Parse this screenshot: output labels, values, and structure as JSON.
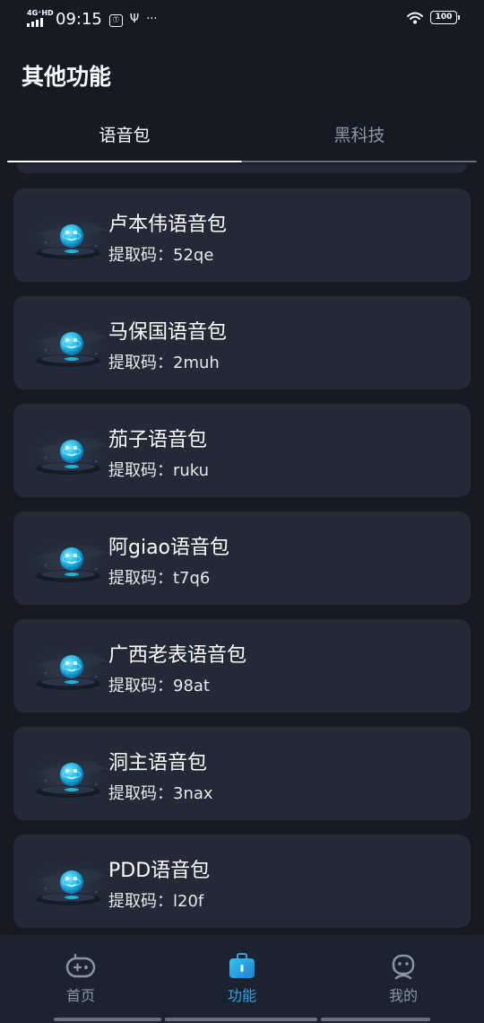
{
  "status_bar": {
    "network": "4G⁺HD",
    "time": "09:15",
    "notif_badge": "Ⓣ",
    "usb_glyph": "Ψ",
    "more": "···",
    "battery": "100"
  },
  "header": {
    "title": "其他功能"
  },
  "tabs": [
    {
      "label": "语音包",
      "active": true
    },
    {
      "label": "黑科技",
      "active": false
    }
  ],
  "voice_packs": [
    {
      "title": "卢本伟语音包",
      "code_label": "提取码：",
      "code": "52qe"
    },
    {
      "title": "马保国语音包",
      "code_label": "提取码：",
      "code": "2muh"
    },
    {
      "title": "茄子语音包",
      "code_label": "提取码：",
      "code": "ruku"
    },
    {
      "title": "阿giao语音包",
      "code_label": "提取码：",
      "code": "t7q6"
    },
    {
      "title": "广西老表语音包",
      "code_label": "提取码：",
      "code": "98at"
    },
    {
      "title": "洞主语音包",
      "code_label": "提取码：",
      "code": "3nax"
    },
    {
      "title": "PDD语音包",
      "code_label": "提取码：",
      "code": "l20f"
    }
  ],
  "bottom_nav": [
    {
      "label": "首页",
      "icon": "gamepad-icon",
      "active": false
    },
    {
      "label": "功能",
      "icon": "toolbox-icon",
      "active": true
    },
    {
      "label": "我的",
      "icon": "robot-face-icon",
      "active": false
    }
  ],
  "colors": {
    "background": "#151a23",
    "card": "#222a37",
    "accent": "#2fa6e6",
    "inactive": "#8a94a3"
  }
}
